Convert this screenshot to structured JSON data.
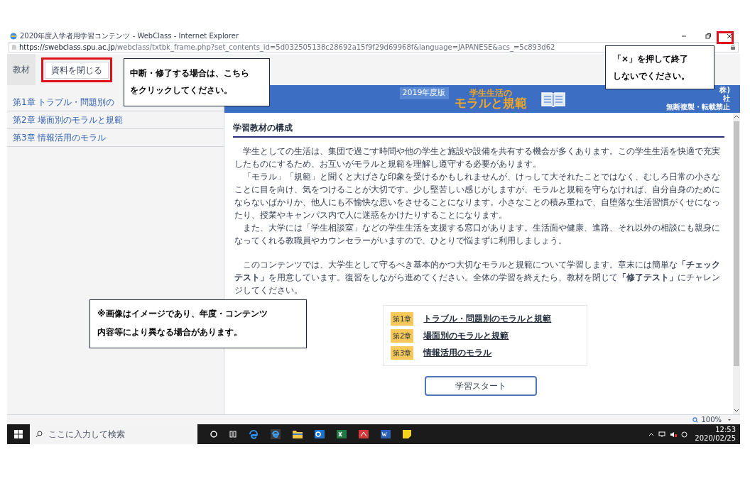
{
  "window": {
    "title": "2020年度入学者用学習コンテンツ - WebClass - Internet Explorer",
    "url_host": "https://swebclass.spu.ac.jp",
    "url_path": "/webclass/txtbk_frame.php?set_contents_id=5d032505138c28692a15f9f29d69968f&language=JAPANESE&acs_=5c893d62"
  },
  "toolbar": {
    "tab": "教材",
    "close_button": "資料を閉じる"
  },
  "sidebar": {
    "items": [
      {
        "label": "第1章 トラブル・問題別の"
      },
      {
        "label": "第2章 場面別のモラルと規範"
      },
      {
        "label": "第3章 情報活用のモラル"
      }
    ]
  },
  "banner": {
    "edition": "2019年度版",
    "title_line1": "学生生活の",
    "title_line2": "モラルと規範",
    "right_texts": [
      "株)",
      "社",
      "無断複製・転載禁止"
    ]
  },
  "content": {
    "heading": "学習教材の構成",
    "paragraphs": [
      "学生としての生活は、集団で過ごす時間や他の学生と施設や設備を共有する機会が多くあります。この学生生活を快適で充実したものにするため、お互いがモラルと規範を理解し遵守する必要があります。",
      "「モラル」「規範」と聞くと大げさな印象を受けるかもしれませんが、けっして大それたことではなく、むしろ日常の小さなことに目を向け、気をつけることが大切です。少し堅苦しい感じがしますが、モラルと規範を守らなければ、自分自身のためにならないばかりか、他人にも不愉快な思いをさせることになります。小さなことの積み重ねで、自堕落な生活習慣がくせになったり、授業やキャンパス内で人に迷惑をかけたりすることになります。",
      "また、大学には「学生相談室」などの学生生活を支援する窓口があります。生活面や健康、進路、それ以外の相談にも親身になってくれる教職員やカウンセラーがいますので、ひとりで悩まずに利用しましょう。",
      "このコンテンツでは、大学生として守るべき基本的かつ大切なモラルと規範について学習します。章末には簡単な**「チェックテスト」**を用意しています。復習をしながら進めてください。全体の学習を終えたら、教材を閉じて**「修了テスト」**にチャレンジしてください。"
    ],
    "chapters": [
      {
        "badge": "第1章",
        "title": "トラブル・問題別のモラルと規範"
      },
      {
        "badge": "第2章",
        "title": "場面別のモラルと規範"
      },
      {
        "badge": "第3章",
        "title": "情報活用のモラル"
      }
    ],
    "start_button": "学習スタート"
  },
  "status_bar": {
    "zoom": "100%"
  },
  "taskbar": {
    "search_placeholder": "ここに入力して検索",
    "time": "12:53",
    "date": "2020/02/25"
  },
  "annotations": [
    {
      "lines": [
        "中断・修了する場合は、こちら",
        "をクリックしてください。"
      ]
    },
    {
      "lines": [
        "「×」を押して終了",
        "しないでください。"
      ]
    },
    {
      "lines": [
        "※画像はイメージであり、年度・コンテンツ",
        "内容等により異なる場合があります。"
      ]
    }
  ]
}
